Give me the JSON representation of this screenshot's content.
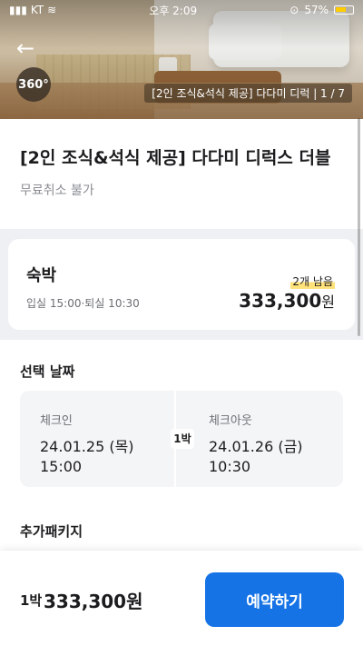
{
  "status_bar": {
    "time": "오후 2:09",
    "carrier": "KT",
    "battery": "57%"
  },
  "hero": {
    "badge_360": "360°",
    "photo_caption": "[2인 조식&석식 제공] 다다미 디럭 | 1 / 7"
  },
  "room": {
    "title": "[2인 조식&석식 제공] 다다미 디럭스 더블",
    "cancel_policy": "무료취소 불가"
  },
  "price_card": {
    "label": "숙박",
    "checkin_checkout": "입실 15:00·퇴실 10:30",
    "remaining": "2개 남음",
    "amount": "333,300",
    "currency": "원"
  },
  "dates": {
    "section_title": "선택 날짜",
    "checkin_label": "체크인",
    "checkin_date": "24.01.25 (목)",
    "checkin_time": "15:00",
    "nights": "1박",
    "checkout_label": "체크아웃",
    "checkout_date": "24.01.26 (금)",
    "checkout_time": "10:30"
  },
  "extra": {
    "section_title": "추가패키지"
  },
  "bottom": {
    "nights": "1박",
    "total": "333,300원",
    "reserve_label": "예약하기"
  }
}
